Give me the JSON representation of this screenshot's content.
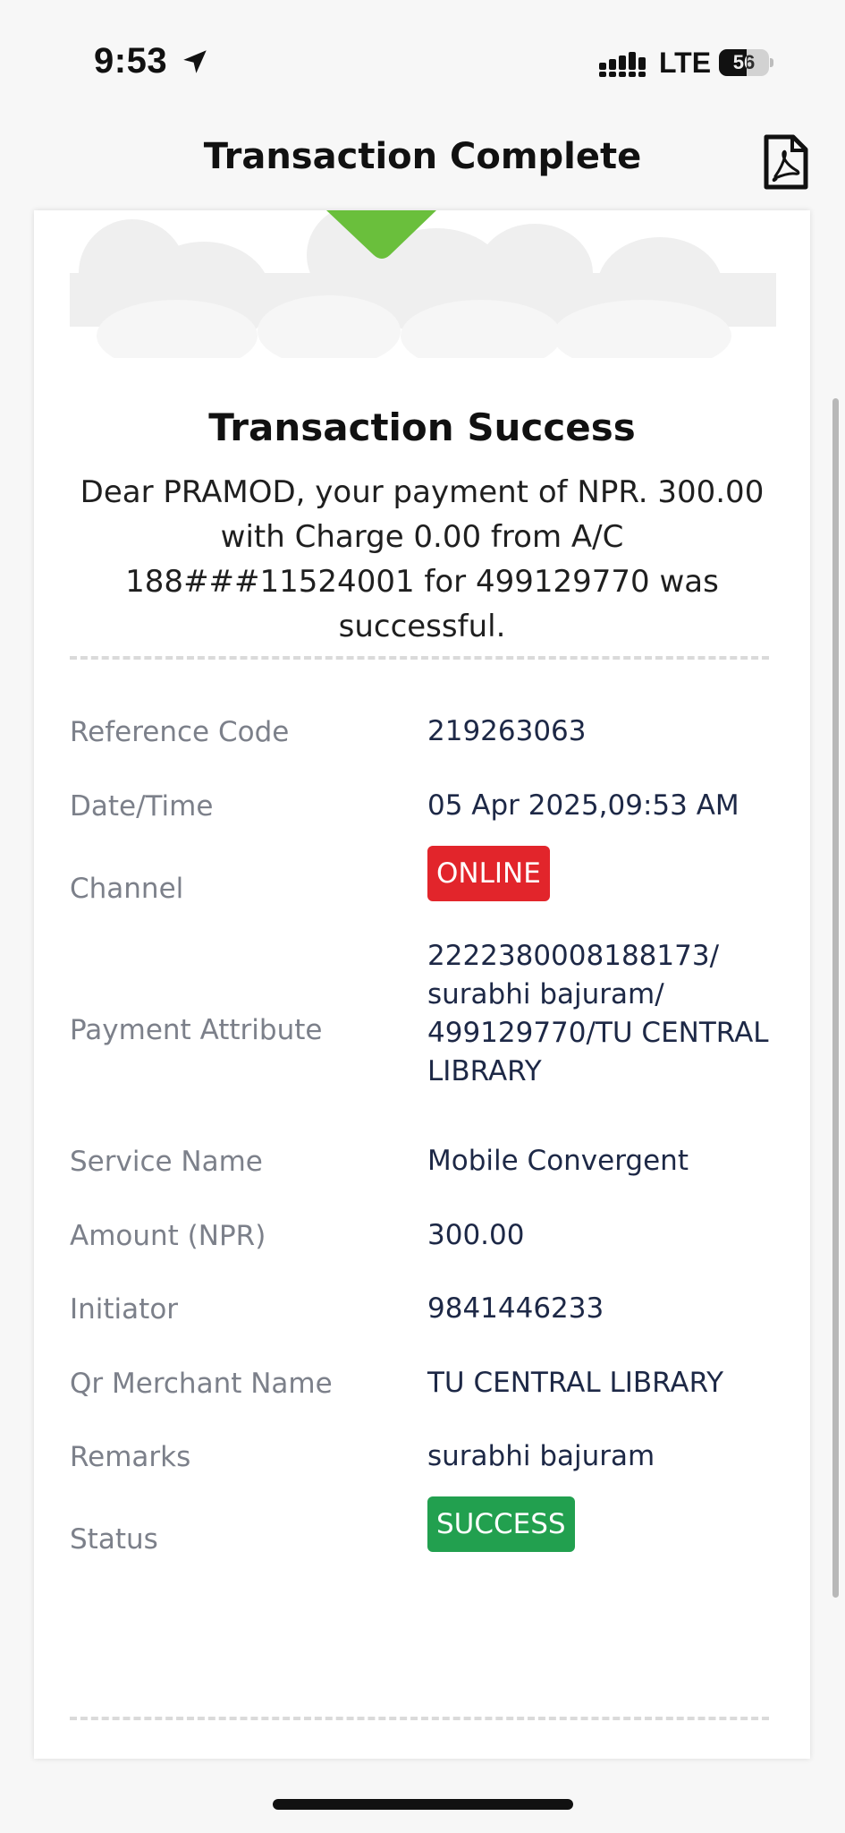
{
  "status_bar": {
    "time": "9:53",
    "network": "LTE",
    "battery_level": "56",
    "battery_fraction": 0.56
  },
  "header": {
    "title": "Transaction Complete",
    "pdf_icon": "pdf-icon"
  },
  "hero": {
    "icon": "checkmark-badge-icon",
    "accent_color": "#6abf3c"
  },
  "summary": {
    "title": "Transaction Success",
    "message": "Dear PRAMOD, your payment of NPR. 300.00 with Charge 0.00 from A/C 188###11524001 for 499129770 was successful."
  },
  "details": {
    "reference_code": {
      "label": "Reference Code",
      "value": "219263063"
    },
    "date_time": {
      "label": "Date/Time",
      "value": "05 Apr 2025,09:53 AM"
    },
    "channel": {
      "label": "Channel",
      "value": "ONLINE",
      "color": "#e2252b"
    },
    "payment_attribute": {
      "label": "Payment Attribute",
      "lines": [
        "2222380008188173/",
        "surabhi bajuram/",
        "499129770/TU CENTRAL",
        "LIBRARY"
      ]
    },
    "service_name": {
      "label": "Service Name",
      "value": "Mobile Convergent"
    },
    "amount": {
      "label": "Amount (NPR)",
      "value": "300.00"
    },
    "initiator": {
      "label": "Initiator",
      "value": "9841446233"
    },
    "qr_merchant": {
      "label": "Qr Merchant Name",
      "value": "TU CENTRAL LIBRARY"
    },
    "remarks": {
      "label": "Remarks",
      "value": "surabhi bajuram"
    },
    "status": {
      "label": "Status",
      "value": "SUCCESS",
      "color": "#22a04f"
    }
  }
}
